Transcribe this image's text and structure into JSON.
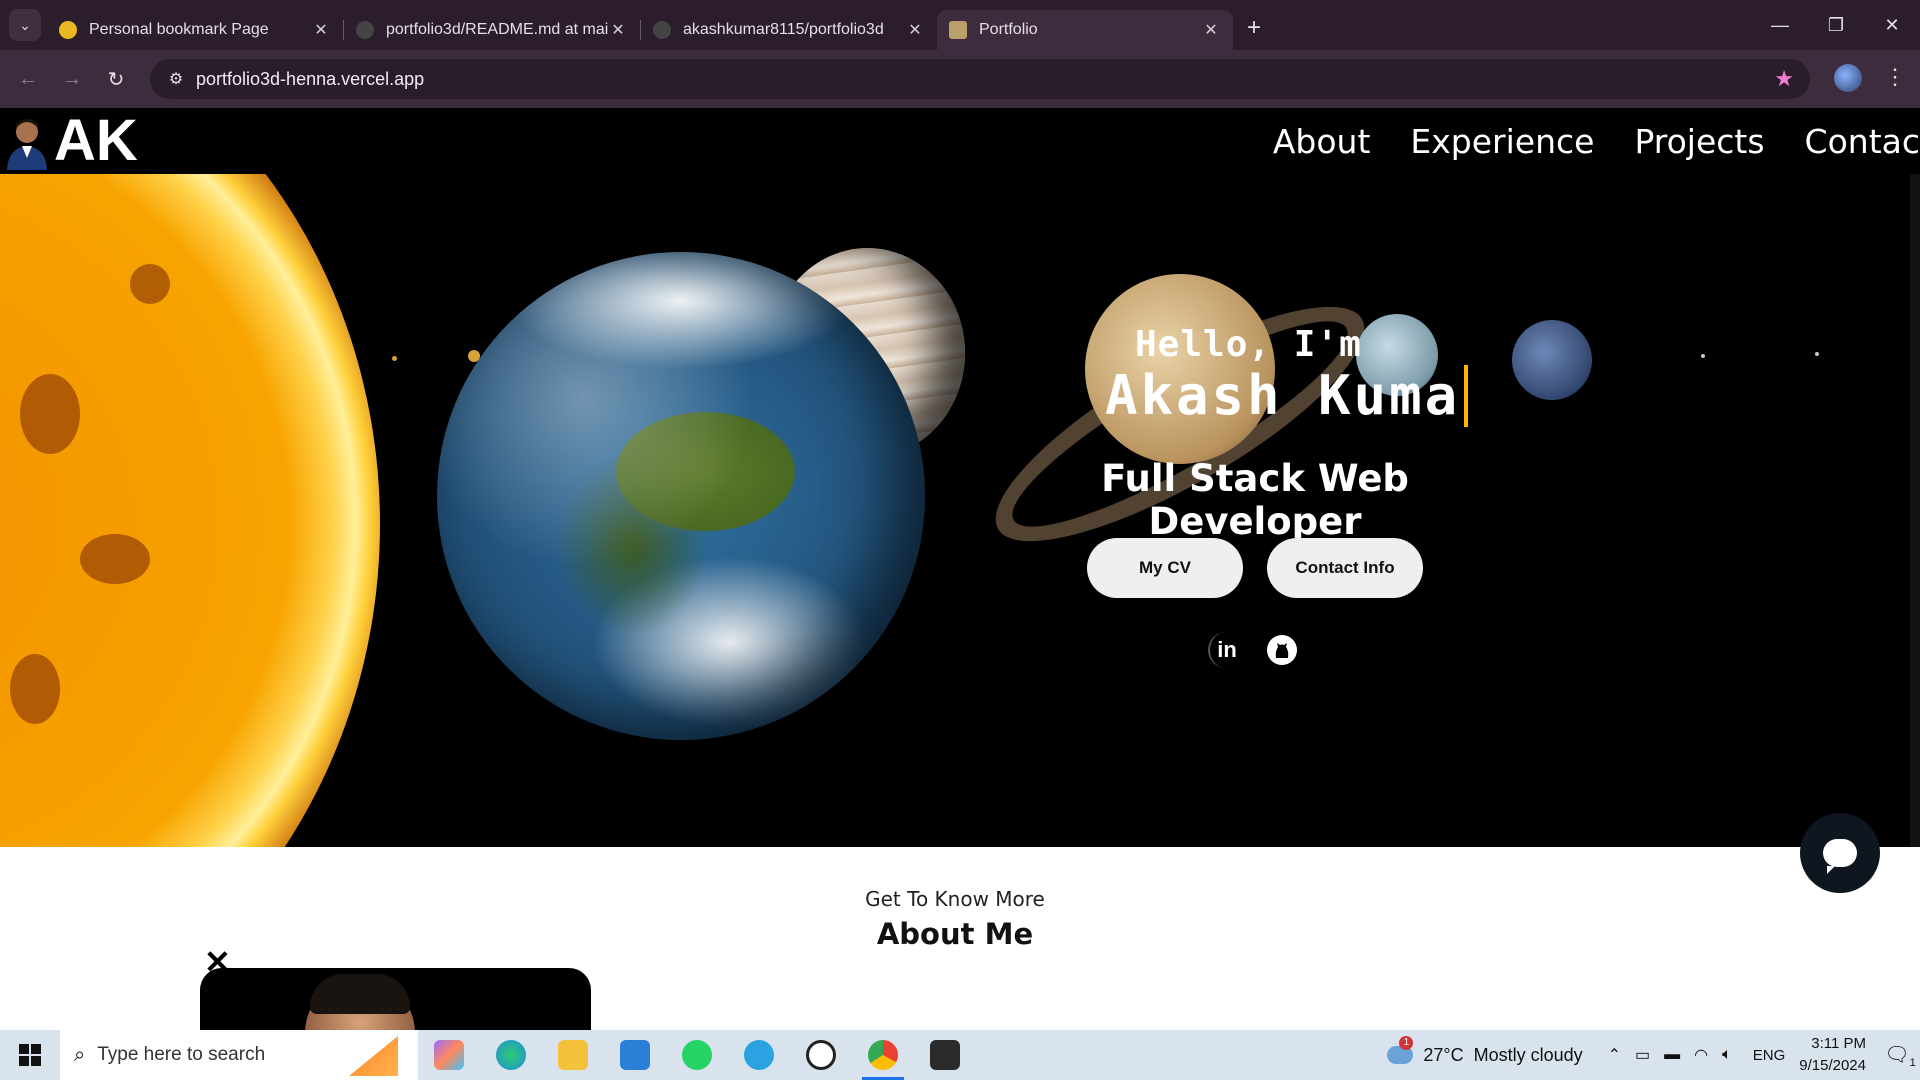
{
  "browser": {
    "tabs": [
      {
        "title": "Personal bookmark Page",
        "favicon_color": "#e8b923",
        "active": false
      },
      {
        "title": "portfolio3d/README.md at mai",
        "favicon_color": "#444444",
        "active": false
      },
      {
        "title": "akashkumar8115/portfolio3d",
        "favicon_color": "#444444",
        "active": false
      },
      {
        "title": "Portfolio",
        "favicon_color": "#b9a06b",
        "active": true
      }
    ],
    "new_tab": "+",
    "url": "portfolio3d-henna.vercel.app",
    "window": {
      "minimize": "—",
      "restore": "❐",
      "close": "✕"
    }
  },
  "site": {
    "logo": "AK",
    "nav": [
      "About",
      "Experience",
      "Projects",
      "Contac"
    ],
    "hero": {
      "greeting": "Hello, I'm",
      "name": "Akash Kuma",
      "role": "Full Stack Web Developer",
      "buttons": {
        "cv": "My CV",
        "contact": "Contact Info"
      },
      "social": {
        "linkedin": "in"
      }
    },
    "about": {
      "subtitle": "Get To Know More",
      "title": "About Me"
    },
    "close_symbol": "✕"
  },
  "taskbar": {
    "search_placeholder": "Type here to search",
    "weather": {
      "temp": "27°C",
      "condition": "Mostly cloudy",
      "alerts": "1"
    },
    "lang": "ENG",
    "time": "3:11 PM",
    "date": "9/15/2024",
    "notifications": "1",
    "apps": [
      {
        "name": "copilot",
        "color": "#9c6bff"
      },
      {
        "name": "edge",
        "color": "#1f8fdc"
      },
      {
        "name": "file-explorer",
        "color": "#f3c13a"
      },
      {
        "name": "vscode",
        "color": "#2b7fd6"
      },
      {
        "name": "whatsapp",
        "color": "#25d366"
      },
      {
        "name": "telegram",
        "color": "#2aa3e0"
      },
      {
        "name": "threads",
        "color": "#222222"
      },
      {
        "name": "chrome",
        "color": "#e94235"
      },
      {
        "name": "terminal",
        "color": "#2b2b2b"
      }
    ]
  }
}
